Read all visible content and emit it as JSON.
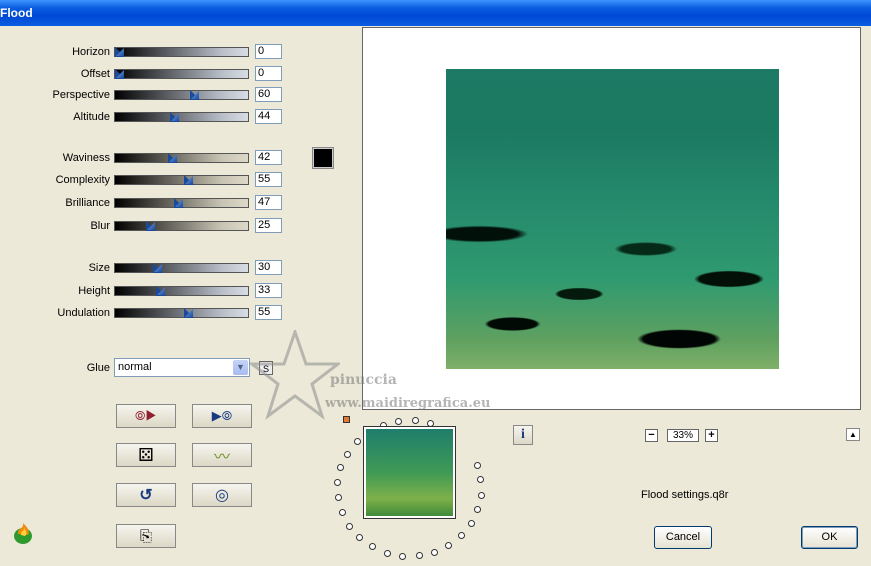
{
  "window": {
    "title": "Flood"
  },
  "sliders": [
    {
      "id": "horizon",
      "label": "Horizon",
      "value": "0",
      "fraction": 0.0,
      "style": "g1"
    },
    {
      "id": "offset",
      "label": "Offset",
      "value": "0",
      "fraction": 0.0,
      "style": "g1"
    },
    {
      "id": "perspective",
      "label": "Perspective",
      "value": "60",
      "fraction": 0.6,
      "style": "g1"
    },
    {
      "id": "altitude",
      "label": "Altitude",
      "value": "44",
      "fraction": 0.44,
      "style": "g1"
    },
    {
      "id": "waviness",
      "label": "Waviness",
      "value": "42",
      "fraction": 0.42,
      "style": "g2"
    },
    {
      "id": "complexity",
      "label": "Complexity",
      "value": "55",
      "fraction": 0.55,
      "style": "g2"
    },
    {
      "id": "brilliance",
      "label": "Brilliance",
      "value": "47",
      "fraction": 0.47,
      "style": "g2"
    },
    {
      "id": "blur",
      "label": "Blur",
      "value": "25",
      "fraction": 0.25,
      "style": "g2"
    },
    {
      "id": "size",
      "label": "Size",
      "value": "30",
      "fraction": 0.3,
      "style": "g1"
    },
    {
      "id": "height",
      "label": "Height",
      "value": "33",
      "fraction": 0.33,
      "style": "g1"
    },
    {
      "id": "undulation",
      "label": "Undulation",
      "value": "55",
      "fraction": 0.55,
      "style": "g1"
    }
  ],
  "color_swatch": "#000000",
  "glue": {
    "label": "Glue",
    "value": "normal",
    "s_button": "S"
  },
  "buttons": {
    "load": "⦾▶",
    "save": "▶⦾",
    "random": "⚄",
    "wave": "〰",
    "undo": "↺",
    "reset": "◎",
    "copy": "⎘"
  },
  "zoom": {
    "value": "33%",
    "minus": "−",
    "plus": "+"
  },
  "info_button": "i",
  "up_button": "▲",
  "settings_file": "Flood settings.q8r",
  "cancel_label": "Cancel",
  "ok_label": "OK",
  "watermark": {
    "name": "pinuccia",
    "url": "www.maidiregrafica.eu"
  }
}
